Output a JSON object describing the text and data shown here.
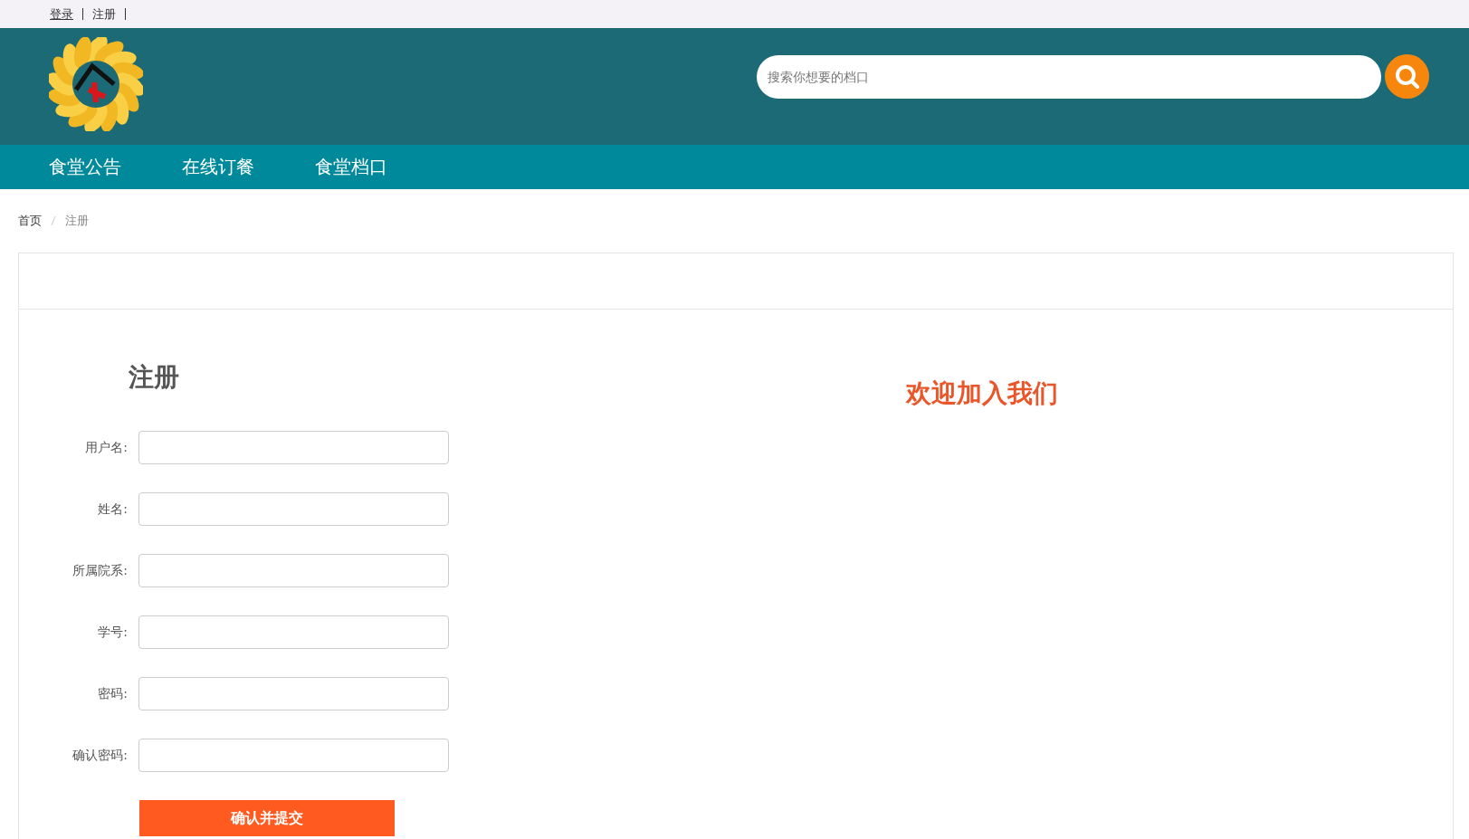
{
  "top_links": [
    {
      "label": "登录"
    },
    {
      "label": "注册"
    }
  ],
  "search": {
    "placeholder": "搜索你想要的档口"
  },
  "nav": [
    {
      "label": "食堂公告"
    },
    {
      "label": "在线订餐"
    },
    {
      "label": "食堂档口"
    }
  ],
  "breadcrumb": [
    "首页",
    "注册"
  ],
  "form": {
    "title": "注册",
    "fields": [
      {
        "label": "用户名:"
      },
      {
        "label": "姓名:"
      },
      {
        "label": "所属院系:"
      },
      {
        "label": "学号:"
      },
      {
        "label": "密码:"
      },
      {
        "label": "确认密码:"
      }
    ],
    "submit": "确认并提交"
  },
  "welcome": "欢迎加入我们"
}
